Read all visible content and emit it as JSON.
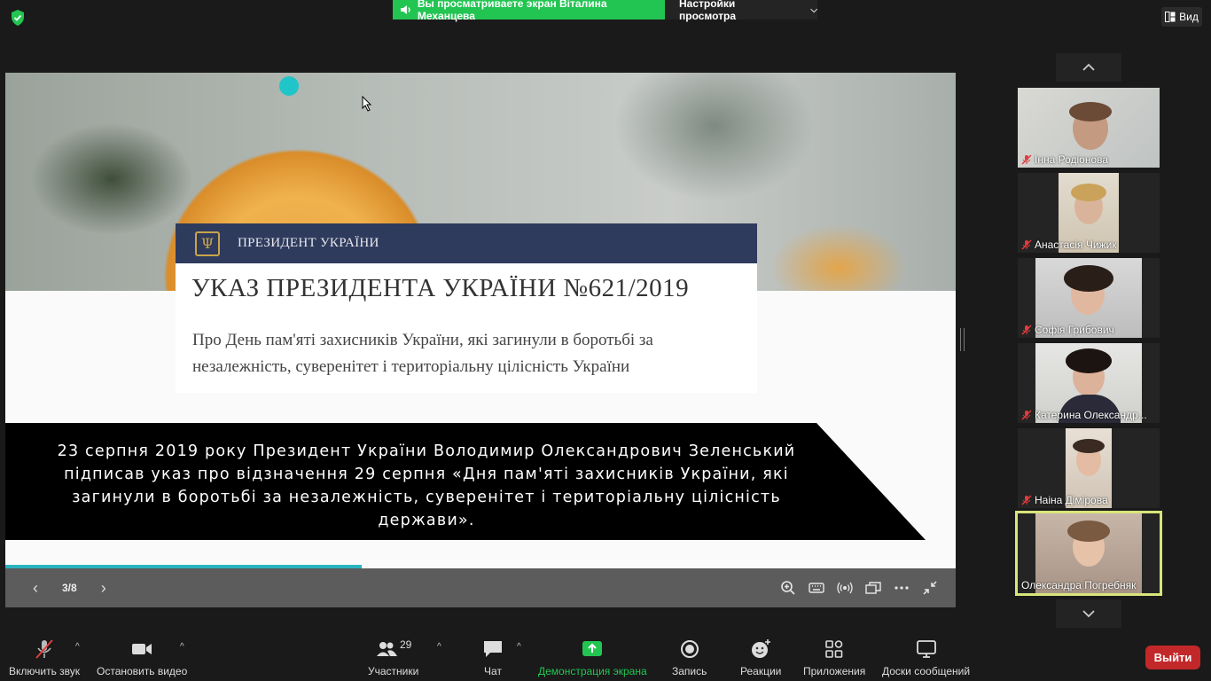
{
  "topbar": {
    "share_text": "Вы просматриваете экран Віталина Механцева",
    "view_options": "Настройки просмотра",
    "view_button": "Вид"
  },
  "slide": {
    "header_label": "ПРЕЗИДЕНТ УКРАЇНИ",
    "decree_title": "УКАЗ ПРЕЗИДЕНТА УКРАЇНИ №621/2019",
    "decree_subtitle": "Про День пам'яті захисників України, які загинули в боротьбі за незалежність, суверенітет і територіальну цілісність України",
    "band_text": "23 серпня 2019 року Президент України Володимир Олександрович Зеленський підписав указ про відзначення 29 серпня «Дня пам'яті захисників України, які загинули в боротьбі за незалежність, суверенітет і територіальну цілісність держави».",
    "page_indicator": "3/8",
    "progress_fraction": 0.375
  },
  "participants": [
    {
      "name": "Інна Родіонова",
      "muted": true
    },
    {
      "name": "Анастасія Чижик",
      "muted": true
    },
    {
      "name": "Софія Грибович",
      "muted": true
    },
    {
      "name": "Катерина Олександр...",
      "muted": true
    },
    {
      "name": "Наіна Дімірова",
      "muted": true
    },
    {
      "name": "Олександра Погребняк",
      "muted": false,
      "active": true
    }
  ],
  "toolbar": {
    "audio": "Включить звук",
    "video": "Остановить видео",
    "participants": "Участники",
    "participants_count": "29",
    "chat": "Чат",
    "share": "Демонстрация экрана",
    "record": "Запись",
    "reactions": "Реакции",
    "apps": "Приложения",
    "whiteboards": "Доски сообщений",
    "leave": "Выйти"
  },
  "colors": {
    "share_green": "#23c552",
    "active_speaker": "#d8e57a",
    "leave_red": "#c2282a",
    "slide_accent": "#2f3b5d"
  }
}
